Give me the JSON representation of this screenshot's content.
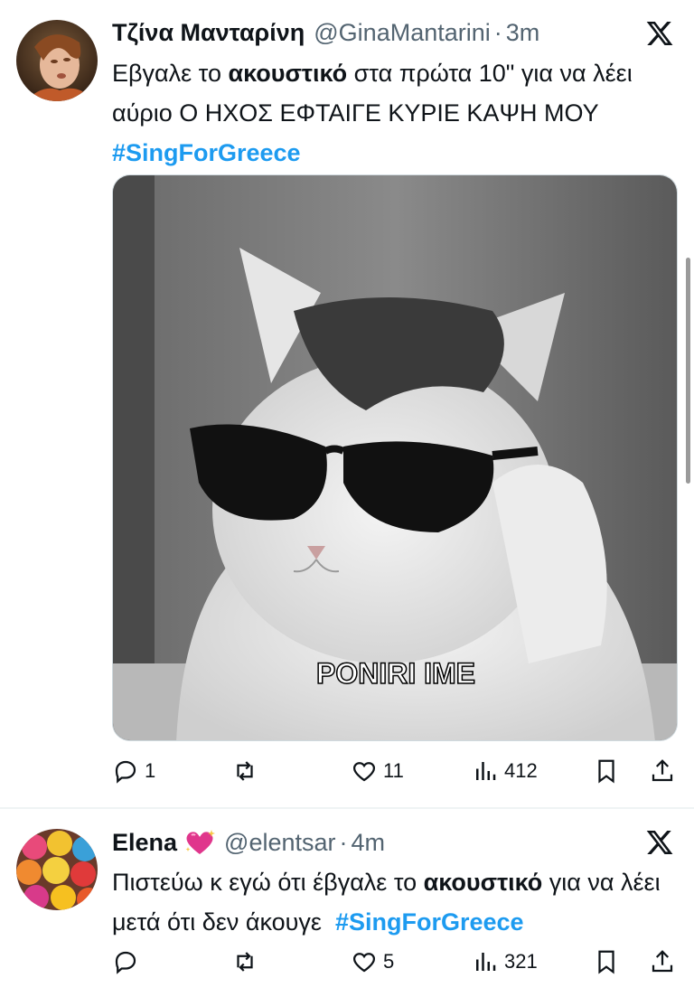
{
  "tweets": [
    {
      "author_name": "Τζίνα Μανταρίνη",
      "handle": "@GinaMantarini",
      "separator": "·",
      "time": "3m",
      "text_parts": [
        "Εβγαλε το ",
        "ακουστικό",
        " στα πρώτα 10\" για να λέει αύριο Ο ΗΧΟΣ ΕΦΤΑΙΓΕ ΚΥΡΙΕ ΚΑΨΗ ΜΟΥ ",
        "#SingForGreece"
      ],
      "media_caption": "PONIRI IME",
      "replies": "1",
      "retweets": "",
      "likes": "11",
      "views": "412"
    },
    {
      "author_name": "Elena",
      "author_emoji": "sparkling-heart",
      "handle": "@elentsar",
      "separator": "·",
      "time": "4m",
      "text_parts": [
        "Πιστεύω κ εγώ ότι έβγαλε το ",
        "ακουστικό",
        " για να λέει μετά ότι δεν άκουγε  ",
        "#SingForGreece"
      ],
      "replies": "",
      "retweets": "",
      "likes": "5",
      "views": "321"
    }
  ],
  "colors": {
    "accent": "#1d9bf0",
    "muted": "#536471",
    "text": "#0f1419",
    "heart_emoji": "#e0368c"
  },
  "icons": [
    "reply-icon",
    "retweet-icon",
    "like-icon",
    "views-icon",
    "bookmark-icon",
    "share-icon",
    "x-logo-icon"
  ]
}
